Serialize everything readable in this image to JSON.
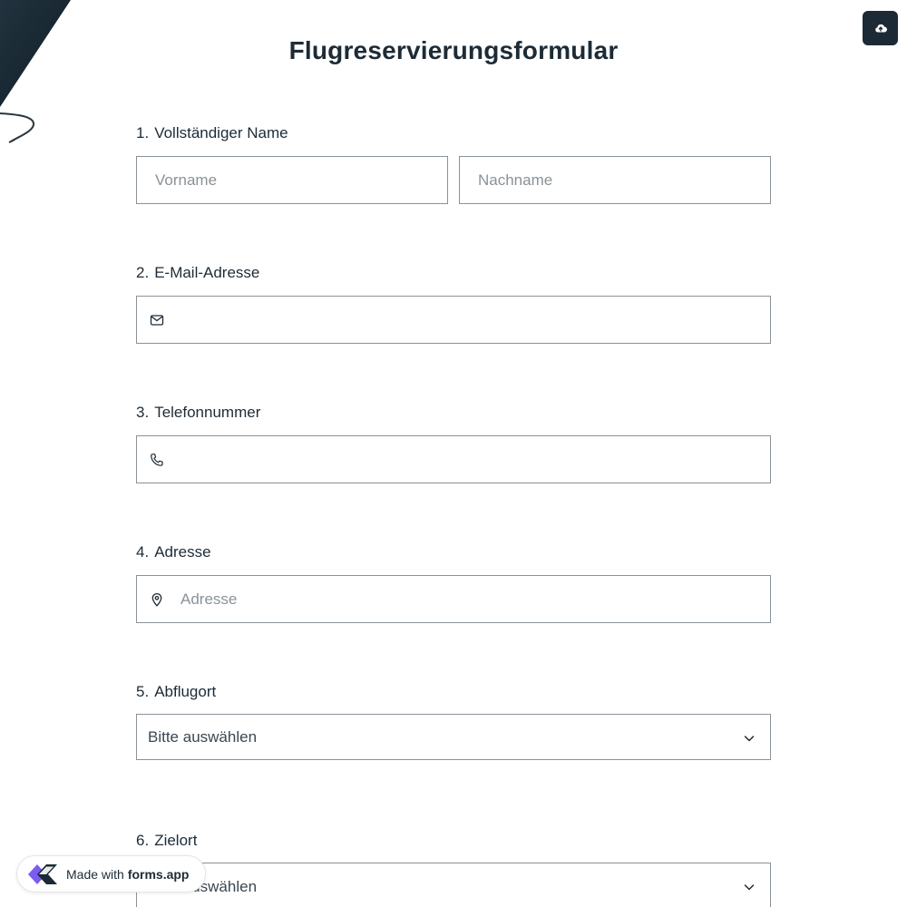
{
  "upload_icon": "cloud-upload-icon",
  "title": "Flugreservierungsformular",
  "questions": [
    {
      "number": "1.",
      "label": "Vollständiger Name",
      "first_placeholder": "Vorname",
      "last_placeholder": "Nachname"
    },
    {
      "number": "2.",
      "label": "E-Mail-Adresse",
      "icon": "mail-icon",
      "value": ""
    },
    {
      "number": "3.",
      "label": "Telefonnummer",
      "icon": "phone-icon",
      "value": ""
    },
    {
      "number": "4.",
      "label": "Adresse",
      "icon": "location-pin-icon",
      "placeholder": "Adresse"
    },
    {
      "number": "5.",
      "label": "Abflugort",
      "selected": "Bitte auswählen",
      "icon": "chevron-down-icon"
    },
    {
      "number": "6.",
      "label": "Zielort",
      "selected": "Bitte auswählen",
      "icon": "chevron-down-icon"
    }
  ],
  "badge": {
    "prefix": "Made with",
    "brand": "forms.app"
  },
  "colors": {
    "dark": "#1b2a35",
    "text": "#1d2b36",
    "border": "#8a9298",
    "logo_purple": "#7b5cf0"
  }
}
